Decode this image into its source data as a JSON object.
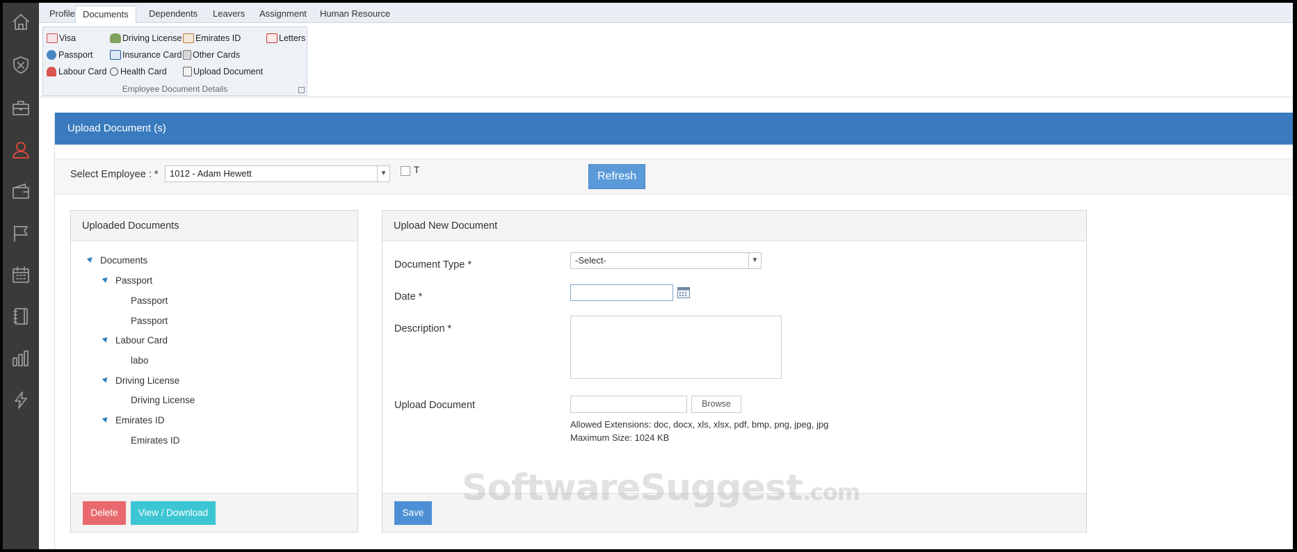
{
  "sidebar": {
    "icons": [
      "home-icon",
      "shield-x-icon",
      "briefcase-icon",
      "user-icon",
      "wallet-icon",
      "flag-icon",
      "calendar-icon",
      "notebook-icon",
      "bar-chart-icon",
      "lightning-icon"
    ],
    "active_icon": "user-icon",
    "active_color": "#e8483d"
  },
  "ribbon": {
    "tabs": [
      {
        "label": "Profile"
      },
      {
        "label": "Documents",
        "active": true
      },
      {
        "label": "Dependents"
      },
      {
        "label": "Leavers"
      },
      {
        "label": "Assignment"
      },
      {
        "label": "Human Resource"
      }
    ],
    "group": {
      "title": "Employee Document Details",
      "items": [
        {
          "label": "Visa",
          "icon": "visa-icon"
        },
        {
          "label": "Driving License",
          "icon": "car-icon"
        },
        {
          "label": "Emirates ID",
          "icon": "id-card-icon"
        },
        {
          "label": "Letters",
          "icon": "letters-icon"
        },
        {
          "label": "Passport",
          "icon": "passport-icon"
        },
        {
          "label": "Insurance Card",
          "icon": "insurance-card-icon"
        },
        {
          "label": "Other Cards",
          "icon": "other-cards-icon"
        },
        {
          "label": "Labour Card",
          "icon": "labour-card-icon"
        },
        {
          "label": "Health Card",
          "icon": "stethoscope-icon"
        },
        {
          "label": "Upload Document",
          "icon": "upload-document-icon"
        }
      ]
    }
  },
  "panel": {
    "title": "Upload Document (s)",
    "header_color": "#3a7bbf",
    "employee": {
      "label": "Select Employee : *",
      "value": "1012 - Adam Hewett",
      "checkbox_label": "T",
      "checkbox_checked": false,
      "refresh_label": "Refresh"
    },
    "uploaded": {
      "title": "Uploaded Documents",
      "tree": {
        "root": "Documents",
        "groups": [
          {
            "label": "Passport",
            "children": [
              "Passport",
              "Passport"
            ]
          },
          {
            "label": "Labour Card",
            "children": [
              "labo"
            ]
          },
          {
            "label": "Driving License",
            "children": [
              "Driving License"
            ]
          },
          {
            "label": "Emirates ID",
            "children": [
              "Emirates ID"
            ]
          }
        ]
      },
      "delete_label": "Delete",
      "view_label": "View / Download"
    },
    "new_document": {
      "title": "Upload New Document",
      "doc_type_label": "Document Type *",
      "doc_type_value": "-Select-",
      "date_label": "Date *",
      "date_value": "",
      "description_label": "Description *",
      "description_value": "",
      "upload_label": "Upload Document",
      "browse_label": "Browse",
      "allowed_extensions": "Allowed Extensions:  doc, docx, xls, xlsx, pdf, bmp, png, jpeg, jpg",
      "max_size": "Maximum Size: 1024 KB",
      "save_label": "Save"
    }
  },
  "watermark": {
    "main": "SoftwareSuggest",
    "suffix": ".com"
  }
}
